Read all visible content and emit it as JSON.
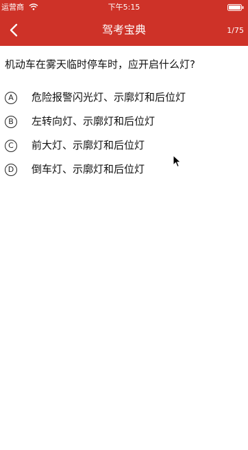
{
  "status_bar": {
    "carrier": "运营商",
    "time": "下午5:15"
  },
  "nav": {
    "title": "驾考宝典",
    "progress": "1/75"
  },
  "question": {
    "text": "机动车在雾天临时停车时，应开启什么灯?",
    "options": [
      {
        "letter": "A",
        "text": "危险报警闪光灯、示廓灯和后位灯"
      },
      {
        "letter": "B",
        "text": "左转向灯、示廓灯和后位灯"
      },
      {
        "letter": "C",
        "text": "前大灯、示廓灯和后位灯"
      },
      {
        "letter": "D",
        "text": "倒车灯、示廓灯和后位灯"
      }
    ]
  },
  "colors": {
    "header_bg": "#ce3228",
    "header_text": "#ffffff",
    "body_text": "#111111"
  },
  "icons": {
    "back": "chevron-left-icon",
    "wifi": "wifi-icon",
    "battery": "battery-icon",
    "cursor": "mouse-pointer-icon"
  }
}
